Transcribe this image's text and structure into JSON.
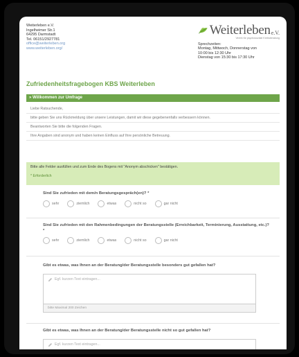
{
  "org": {
    "name": "Weiterleben e.V.",
    "street": "Ingelheimer Str.1",
    "city": "64295 Darmstadt",
    "phone": "Tel. 06151/2927781",
    "email": "office@weiterleben.org",
    "website": "www.weiterleben.org/"
  },
  "brand": {
    "logo_text": "Weiterleben",
    "logo_suffix": "e.V.",
    "tagline": "Verein für psychosoziale Krebsberatung",
    "hours_title": "Sprechzeiten:",
    "hours_line1": "Montag, Mittwoch, Donnerstag von",
    "hours_line2": "10:00 bis 12:30 Uhr",
    "hours_line3": "Dienstag von 15:30 bis 17:30 Uhr"
  },
  "form": {
    "title": "Zufriedenheitsfragebogen KBS Weiterleben",
    "section_title": "» Willkommen zur Umfrage",
    "intro_lines": [
      "Liebe Ratsuchende,",
      "bitte geben Sie uns Rückmeldung über unsere Leistungen, damit wir diese gegebenenfalls verbessern können.",
      "Beantworten Sie bitte die folgenden Fragen.",
      "Ihre Angaben sind anonym und haben keinen Einfluss auf Ihre persönliche Betreuung."
    ],
    "notice": "Bitte alle Felder ausfüllen und zum Ende des Bogens mit \"Anonym abschicken\" bestätigen.",
    "required_note": "* Erforderlich"
  },
  "questions": [
    {
      "text": "Sind Sie zufrieden mit dem/n Beratungsgespräch(en)? *",
      "options": [
        "sehr",
        "ziemlich",
        "etwas",
        "nicht so",
        "gar nicht"
      ]
    },
    {
      "text": "Sind Sie zufrieden mit den Rahmenbedingungen der Beratungsstelle (Erreichbarkeit, Terminierung, Ausstattung, etc.)? *",
      "options": [
        "sehr",
        "ziemlich",
        "etwas",
        "nicht so",
        "gar nicht"
      ]
    },
    {
      "text": "Gibt es etwas, was Ihnen an der Beratung/der Beratungsstelle besonders gut gefallen hat?",
      "placeholder": "Egf. kurzen Text eintragen...",
      "counter": "bitte Maximal 200 Zeichen"
    },
    {
      "text": "Gibt es etwas, was Ihnen an der Beratung/der Beratungsstelle nicht so gut gefallen hat?",
      "placeholder": "Egf. kurzen Text eintragen..."
    }
  ],
  "colors": {
    "accent": "#6ea54a",
    "notice_bg": "#d7ecb8",
    "link": "#6e95c4"
  }
}
